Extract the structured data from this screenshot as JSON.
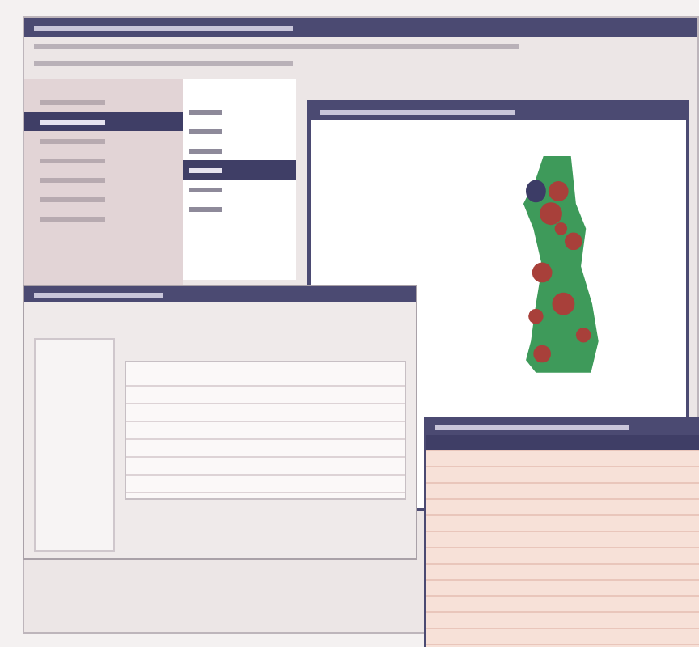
{
  "main_window": {
    "sidebar_items": [
      {
        "selected": false
      },
      {
        "selected": true
      },
      {
        "selected": false
      },
      {
        "selected": false
      },
      {
        "selected": false
      },
      {
        "selected": false
      },
      {
        "selected": false
      }
    ],
    "tree_items": [
      {
        "selected": false
      },
      {
        "selected": false
      },
      {
        "selected": false
      },
      {
        "selected": true
      },
      {
        "selected": false
      },
      {
        "selected": false
      }
    ]
  },
  "map_window": {
    "layer_visible": true
  },
  "table_window": {
    "rows": [
      {
        "selected": false
      },
      {
        "selected": false
      },
      {
        "selected": false
      },
      {
        "selected": false
      },
      {
        "selected": false
      },
      {
        "selected": false
      },
      {
        "selected": false
      }
    ]
  },
  "attribute_window": {
    "rows": [
      {
        "selected": true
      },
      {
        "selected": false
      },
      {
        "selected": false
      },
      {
        "selected": false
      },
      {
        "selected": false
      },
      {
        "selected": false
      },
      {
        "selected": false
      },
      {
        "selected": false
      },
      {
        "selected": false
      },
      {
        "selected": false
      },
      {
        "selected": false
      },
      {
        "selected": false
      },
      {
        "selected": false
      }
    ]
  }
}
